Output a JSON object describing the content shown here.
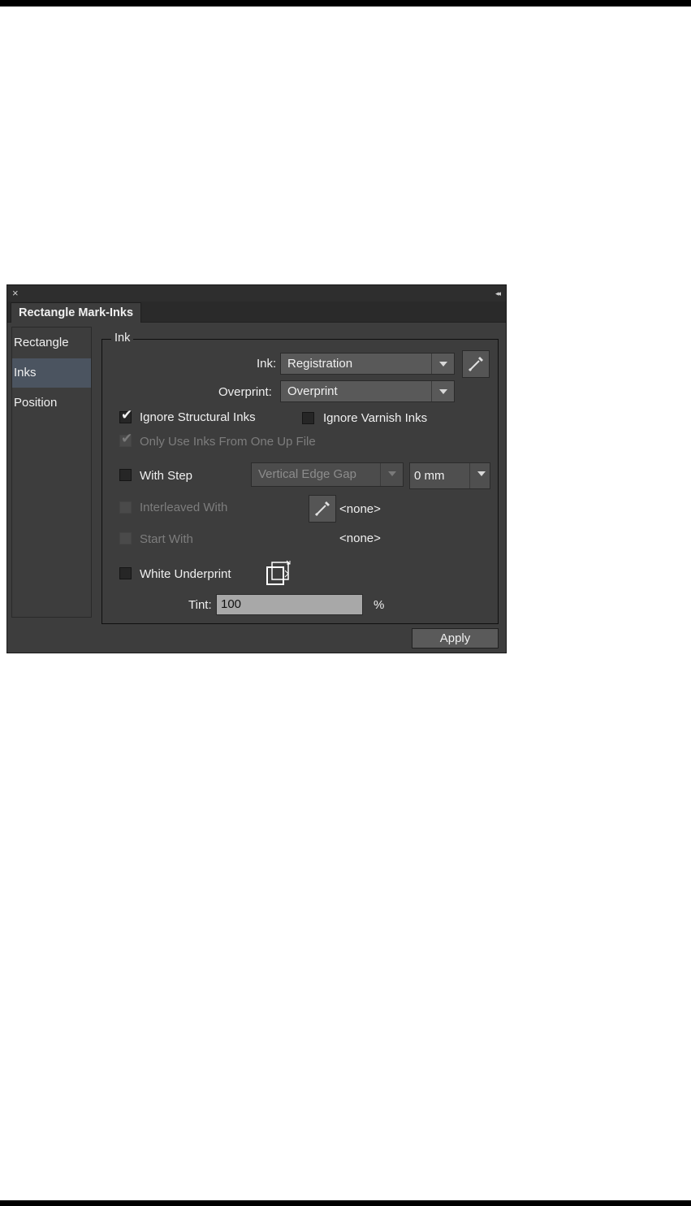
{
  "panel": {
    "tab_label": "Rectangle Mark-Inks"
  },
  "sidebar": {
    "items": [
      {
        "label": "Rectangle"
      },
      {
        "label": "Inks"
      },
      {
        "label": "Position"
      }
    ],
    "selected": "Inks"
  },
  "ink_group": {
    "legend": "Ink",
    "ink_label": "Ink:",
    "ink_value": "Registration",
    "overprint_label": "Overprint:",
    "overprint_value": "Overprint",
    "ignore_structural_inks": {
      "label": "Ignore Structural Inks",
      "checked": true
    },
    "ignore_varnish_inks": {
      "label": "Ignore Varnish Inks",
      "checked": false
    },
    "only_use_inks": {
      "label": "Only Use Inks From One Up File",
      "checked": true,
      "enabled": false
    },
    "with_step": {
      "label": "With Step",
      "checked": false
    },
    "step_mode_value": "Vertical Edge Gap",
    "step_amount_value": "0 mm",
    "interleaved_with": {
      "label": "Interleaved With",
      "checked": false,
      "enabled": false
    },
    "interleaved_value": "<none>",
    "start_with": {
      "label": "Start With",
      "checked": false,
      "enabled": false
    },
    "start_with_value": "<none>",
    "white_underprint": {
      "label": "White Underprint",
      "checked": false
    },
    "tint_label": "Tint:",
    "tint_value": "100",
    "tint_unit": "%"
  },
  "footer": {
    "apply_label": "Apply"
  }
}
